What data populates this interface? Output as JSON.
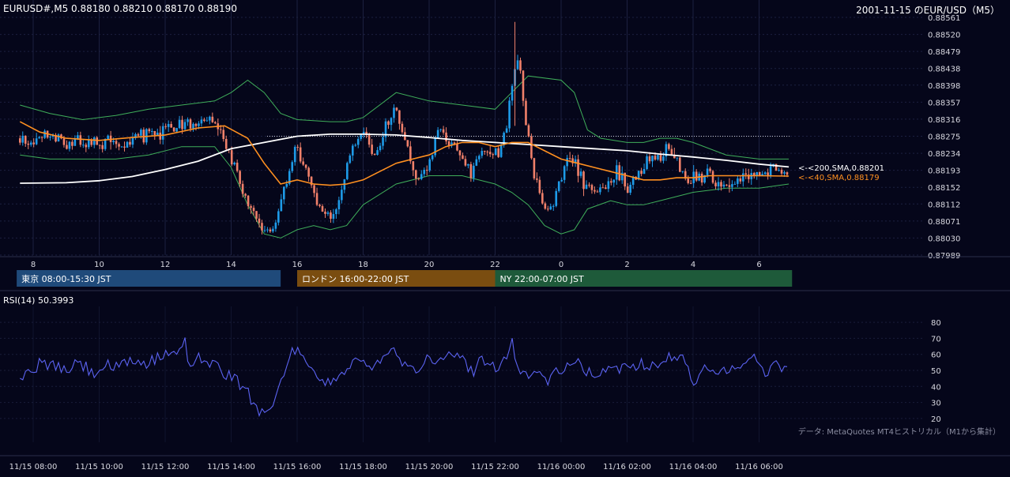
{
  "header": {
    "ohlc": "EURUSD#,M5 0.88180 0.88210 0.88170 0.88190",
    "title": "2001-11-15 のEUR/USD（M5）"
  },
  "colors": {
    "background": "#05061a",
    "grid": "#1c2040",
    "up": "#1e9be8",
    "down": "#f0806a",
    "sma200": "#ffffff",
    "sma40": "#ff9020",
    "bollinger": "#3fae5a",
    "rsi": "#5b63f2",
    "tokyo": "#1f4a7a",
    "london": "#7a4d10",
    "ny": "#1e5a3a"
  },
  "sessions": [
    {
      "label": "東京 08:00-15:30 JST",
      "start_hour": 7.5,
      "end_hour": 15.5,
      "color_key": "tokyo"
    },
    {
      "label": "ロンドン 16:00-22:00 JST",
      "start_hour": 16,
      "end_hour": 22,
      "color_key": "london"
    },
    {
      "label": "NY 22:00-07:00 JST",
      "start_hour": 22,
      "end_hour": 31,
      "color_key": "ny"
    }
  ],
  "sma200_label": "<-<200,SMA,0.88201",
  "sma40_label": "<-<40,SMA,0.88179",
  "rsi_label": "RSI(14) 50.3993",
  "source_note": "データ: MetaQuotes MT4ヒストリカル（M1から集計）",
  "chart_data": {
    "type": "candlestick",
    "symbol": "EURUSD#",
    "timeframe": "M5",
    "x_range_hours": [
      7.6,
      30.9
    ],
    "price_axis": {
      "ylim": [
        0.87989,
        0.88561
      ],
      "ticks": [
        "0.88561",
        "0.88520",
        "0.88479",
        "0.88438",
        "0.88398",
        "0.88357",
        "0.88316",
        "0.88275",
        "0.88234",
        "0.88193",
        "0.88152",
        "0.88112",
        "0.88071",
        "0.88030",
        "0.87989"
      ]
    },
    "hour_ticks": [
      {
        "hour": 8,
        "label": "8"
      },
      {
        "hour": 10,
        "label": "10"
      },
      {
        "hour": 12,
        "label": "12"
      },
      {
        "hour": 14,
        "label": "14"
      },
      {
        "hour": 16,
        "label": "16"
      },
      {
        "hour": 18,
        "label": "18"
      },
      {
        "hour": 20,
        "label": "20"
      },
      {
        "hour": 22,
        "label": "22"
      },
      {
        "hour": 24,
        "label": "0"
      },
      {
        "hour": 26,
        "label": "2"
      },
      {
        "hour": 28,
        "label": "4"
      },
      {
        "hour": 30,
        "label": "6"
      }
    ],
    "date_ticks": [
      {
        "hour": 8,
        "label": "11/15 08:00"
      },
      {
        "hour": 10,
        "label": "11/15 10:00"
      },
      {
        "hour": 12,
        "label": "11/15 12:00"
      },
      {
        "hour": 14,
        "label": "11/15 14:00"
      },
      {
        "hour": 16,
        "label": "11/15 16:00"
      },
      {
        "hour": 18,
        "label": "11/15 18:00"
      },
      {
        "hour": 20,
        "label": "11/15 20:00"
      },
      {
        "hour": 22,
        "label": "11/15 22:00"
      },
      {
        "hour": 24,
        "label": "11/16 00:00"
      },
      {
        "hour": 26,
        "label": "11/16 02:00"
      },
      {
        "hour": 28,
        "label": "11/16 04:00"
      },
      {
        "hour": 30,
        "label": "11/16 06:00"
      }
    ],
    "reference_price": 0.88275,
    "close_path": [
      [
        7.6,
        0.8827
      ],
      [
        8.0,
        0.8826
      ],
      [
        8.5,
        0.8827
      ],
      [
        9.0,
        0.8826
      ],
      [
        9.5,
        0.88265
      ],
      [
        10.0,
        0.88255
      ],
      [
        10.5,
        0.8826
      ],
      [
        11.0,
        0.8827
      ],
      [
        11.5,
        0.88285
      ],
      [
        12.0,
        0.8829
      ],
      [
        12.5,
        0.88305
      ],
      [
        13.0,
        0.88295
      ],
      [
        13.3,
        0.8831
      ],
      [
        13.7,
        0.8829
      ],
      [
        14.0,
        0.8822
      ],
      [
        14.3,
        0.8815
      ],
      [
        14.7,
        0.8809
      ],
      [
        15.0,
        0.8806
      ],
      [
        15.3,
        0.8805
      ],
      [
        15.6,
        0.8815
      ],
      [
        16.0,
        0.8826
      ],
      [
        16.3,
        0.8818
      ],
      [
        16.6,
        0.8811
      ],
      [
        17.0,
        0.8807
      ],
      [
        17.3,
        0.8814
      ],
      [
        17.6,
        0.8823
      ],
      [
        18.0,
        0.8829
      ],
      [
        18.3,
        0.8822
      ],
      [
        18.6,
        0.8829
      ],
      [
        19.0,
        0.8835
      ],
      [
        19.3,
        0.8825
      ],
      [
        19.6,
        0.8818
      ],
      [
        20.0,
        0.8821
      ],
      [
        20.3,
        0.8829
      ],
      [
        20.6,
        0.8826
      ],
      [
        21.0,
        0.8822
      ],
      [
        21.3,
        0.8818
      ],
      [
        21.6,
        0.8825
      ],
      [
        22.0,
        0.8823
      ],
      [
        22.3,
        0.8828
      ],
      [
        22.5,
        0.8838
      ],
      [
        22.7,
        0.8847
      ],
      [
        23.0,
        0.8826
      ],
      [
        23.3,
        0.8814
      ],
      [
        23.6,
        0.8809
      ],
      [
        24.0,
        0.8818
      ],
      [
        24.3,
        0.8822
      ],
      [
        24.6,
        0.8818
      ],
      [
        25.0,
        0.8814
      ],
      [
        25.3,
        0.8815
      ],
      [
        25.7,
        0.8819
      ],
      [
        26.0,
        0.8815
      ],
      [
        26.3,
        0.8818
      ],
      [
        26.7,
        0.8823
      ],
      [
        27.0,
        0.8822
      ],
      [
        27.3,
        0.8826
      ],
      [
        27.6,
        0.8818
      ],
      [
        28.0,
        0.8817
      ],
      [
        28.4,
        0.8819
      ],
      [
        28.8,
        0.8815
      ],
      [
        29.2,
        0.8816
      ],
      [
        29.6,
        0.8818
      ],
      [
        30.0,
        0.8819
      ],
      [
        30.4,
        0.882
      ],
      [
        30.9,
        0.8819
      ]
    ],
    "sma40": [
      [
        7.6,
        0.8831
      ],
      [
        8.2,
        0.88285
      ],
      [
        9.0,
        0.8827
      ],
      [
        10.0,
        0.88265
      ],
      [
        11.0,
        0.88272
      ],
      [
        12.0,
        0.88278
      ],
      [
        13.0,
        0.88295
      ],
      [
        13.8,
        0.883
      ],
      [
        14.5,
        0.8827
      ],
      [
        15.0,
        0.8821
      ],
      [
        15.5,
        0.8816
      ],
      [
        16.0,
        0.8817
      ],
      [
        16.5,
        0.8816
      ],
      [
        17.0,
        0.88157
      ],
      [
        17.5,
        0.8816
      ],
      [
        18.0,
        0.8817
      ],
      [
        18.5,
        0.8819
      ],
      [
        19.0,
        0.8821
      ],
      [
        19.5,
        0.8822
      ],
      [
        20.0,
        0.8823
      ],
      [
        20.5,
        0.8825
      ],
      [
        21.0,
        0.8826
      ],
      [
        21.5,
        0.8826
      ],
      [
        22.0,
        0.8825
      ],
      [
        22.5,
        0.8826
      ],
      [
        23.0,
        0.8826
      ],
      [
        23.5,
        0.8824
      ],
      [
        24.0,
        0.8822
      ],
      [
        24.5,
        0.8821
      ],
      [
        25.0,
        0.882
      ],
      [
        25.5,
        0.8819
      ],
      [
        26.0,
        0.8818
      ],
      [
        26.5,
        0.8817
      ],
      [
        27.0,
        0.8817
      ],
      [
        27.5,
        0.88175
      ],
      [
        28.0,
        0.88175
      ],
      [
        28.5,
        0.8818
      ],
      [
        29.0,
        0.8818
      ],
      [
        29.5,
        0.8818
      ],
      [
        30.0,
        0.8818
      ],
      [
        30.9,
        0.88179
      ]
    ],
    "sma200": [
      [
        7.6,
        0.88162
      ],
      [
        9.0,
        0.88163
      ],
      [
        10.0,
        0.88168
      ],
      [
        11.0,
        0.88178
      ],
      [
        12.0,
        0.88195
      ],
      [
        13.0,
        0.88215
      ],
      [
        14.0,
        0.88245
      ],
      [
        15.0,
        0.8826
      ],
      [
        16.0,
        0.88275
      ],
      [
        17.0,
        0.8828
      ],
      [
        18.0,
        0.8828
      ],
      [
        19.0,
        0.88278
      ],
      [
        20.0,
        0.88272
      ],
      [
        21.0,
        0.88265
      ],
      [
        22.0,
        0.8826
      ],
      [
        23.0,
        0.88255
      ],
      [
        24.0,
        0.8825
      ],
      [
        25.0,
        0.88245
      ],
      [
        26.0,
        0.8824
      ],
      [
        27.0,
        0.88232
      ],
      [
        28.0,
        0.88225
      ],
      [
        29.0,
        0.88217
      ],
      [
        30.0,
        0.88208
      ],
      [
        30.9,
        0.88201
      ]
    ],
    "bollinger_upper": [
      [
        7.6,
        0.8835
      ],
      [
        8.5,
        0.8833
      ],
      [
        9.5,
        0.88315
      ],
      [
        10.5,
        0.88325
      ],
      [
        11.5,
        0.8834
      ],
      [
        12.5,
        0.8835
      ],
      [
        13.5,
        0.8836
      ],
      [
        14.0,
        0.8838
      ],
      [
        14.5,
        0.8841
      ],
      [
        15.0,
        0.8838
      ],
      [
        15.5,
        0.8833
      ],
      [
        16.0,
        0.88315
      ],
      [
        17.0,
        0.8831
      ],
      [
        17.5,
        0.8831
      ],
      [
        18.0,
        0.8832
      ],
      [
        19.0,
        0.8838
      ],
      [
        20.0,
        0.8836
      ],
      [
        21.0,
        0.8835
      ],
      [
        22.0,
        0.8834
      ],
      [
        22.5,
        0.8838
      ],
      [
        23.0,
        0.8842
      ],
      [
        24.0,
        0.8841
      ],
      [
        24.4,
        0.8838
      ],
      [
        24.8,
        0.8829
      ],
      [
        25.2,
        0.8827
      ],
      [
        26.0,
        0.8826
      ],
      [
        26.5,
        0.8826
      ],
      [
        27.0,
        0.8827
      ],
      [
        27.5,
        0.8827
      ],
      [
        28.0,
        0.8826
      ],
      [
        29.0,
        0.8823
      ],
      [
        30.0,
        0.8822
      ],
      [
        30.9,
        0.8822
      ]
    ],
    "bollinger_lower": [
      [
        7.6,
        0.8823
      ],
      [
        8.5,
        0.8822
      ],
      [
        9.5,
        0.8822
      ],
      [
        10.5,
        0.8822
      ],
      [
        11.5,
        0.8823
      ],
      [
        12.5,
        0.8825
      ],
      [
        13.5,
        0.8825
      ],
      [
        14.0,
        0.882
      ],
      [
        14.5,
        0.8811
      ],
      [
        15.0,
        0.8804
      ],
      [
        15.5,
        0.8803
      ],
      [
        16.0,
        0.8805
      ],
      [
        16.5,
        0.8806
      ],
      [
        17.0,
        0.8805
      ],
      [
        17.5,
        0.8806
      ],
      [
        18.0,
        0.8811
      ],
      [
        19.0,
        0.8816
      ],
      [
        20.0,
        0.8818
      ],
      [
        21.0,
        0.8818
      ],
      [
        22.0,
        0.8816
      ],
      [
        22.5,
        0.8814
      ],
      [
        23.0,
        0.8811
      ],
      [
        23.5,
        0.8806
      ],
      [
        24.0,
        0.8804
      ],
      [
        24.4,
        0.8805
      ],
      [
        24.8,
        0.881
      ],
      [
        25.5,
        0.8812
      ],
      [
        26.0,
        0.8811
      ],
      [
        26.5,
        0.8811
      ],
      [
        27.0,
        0.8812
      ],
      [
        28.0,
        0.8814
      ],
      [
        29.0,
        0.8815
      ],
      [
        30.0,
        0.8815
      ],
      [
        30.9,
        0.8816
      ]
    ],
    "rsi_axis": {
      "ylim": [
        15,
        85
      ],
      "ticks": [
        80,
        70,
        60,
        50,
        40,
        30,
        20
      ]
    },
    "rsi_path": [
      [
        7.6,
        45
      ],
      [
        8.0,
        50
      ],
      [
        8.3,
        56
      ],
      [
        8.6,
        52
      ],
      [
        9.0,
        50
      ],
      [
        9.4,
        55
      ],
      [
        9.8,
        48
      ],
      [
        10.2,
        53
      ],
      [
        10.6,
        51
      ],
      [
        11.0,
        56
      ],
      [
        11.4,
        54
      ],
      [
        11.8,
        58
      ],
      [
        12.2,
        62
      ],
      [
        12.6,
        67
      ],
      [
        12.8,
        48
      ],
      [
        13.0,
        58
      ],
      [
        13.4,
        55
      ],
      [
        13.8,
        48
      ],
      [
        14.2,
        43
      ],
      [
        14.5,
        36
      ],
      [
        14.8,
        26
      ],
      [
        15.0,
        24
      ],
      [
        15.2,
        30
      ],
      [
        15.4,
        35
      ],
      [
        15.6,
        46
      ],
      [
        15.8,
        60
      ],
      [
        16.0,
        62
      ],
      [
        16.2,
        55
      ],
      [
        16.5,
        48
      ],
      [
        16.8,
        41
      ],
      [
        17.1,
        45
      ],
      [
        17.4,
        50
      ],
      [
        17.8,
        56
      ],
      [
        18.2,
        52
      ],
      [
        18.6,
        60
      ],
      [
        18.9,
        64
      ],
      [
        19.2,
        55
      ],
      [
        19.6,
        51
      ],
      [
        20.0,
        58
      ],
      [
        20.4,
        54
      ],
      [
        20.7,
        62
      ],
      [
        21.0,
        56
      ],
      [
        21.3,
        49
      ],
      [
        21.6,
        57
      ],
      [
        22.0,
        52
      ],
      [
        22.3,
        58
      ],
      [
        22.5,
        68
      ],
      [
        22.7,
        52
      ],
      [
        23.0,
        46
      ],
      [
        23.3,
        49
      ],
      [
        23.6,
        44
      ],
      [
        24.0,
        50
      ],
      [
        24.4,
        55
      ],
      [
        24.8,
        50
      ],
      [
        25.2,
        46
      ],
      [
        25.6,
        53
      ],
      [
        26.0,
        51
      ],
      [
        26.4,
        55
      ],
      [
        26.8,
        53
      ],
      [
        27.2,
        57
      ],
      [
        27.6,
        59
      ],
      [
        28.0,
        44
      ],
      [
        28.4,
        51
      ],
      [
        28.8,
        49
      ],
      [
        29.2,
        53
      ],
      [
        29.6,
        55
      ],
      [
        30.0,
        58
      ],
      [
        30.2,
        45
      ],
      [
        30.4,
        52
      ],
      [
        30.6,
        54
      ],
      [
        30.9,
        50.4
      ]
    ]
  }
}
